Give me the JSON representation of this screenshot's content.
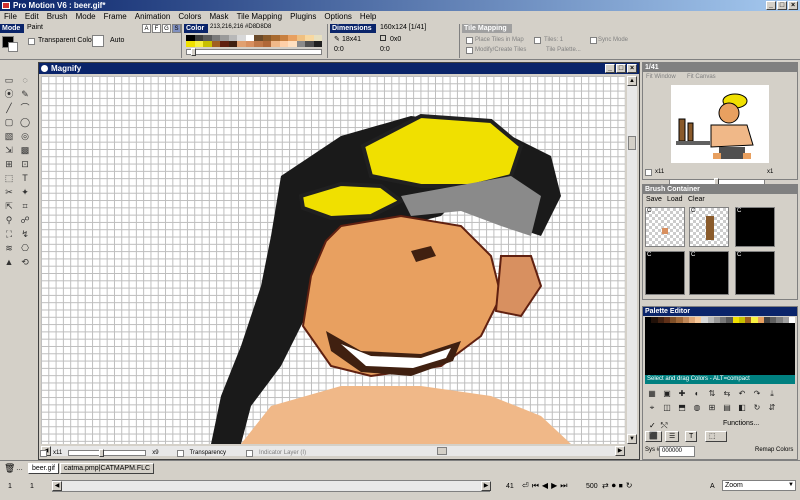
{
  "window": {
    "title": "Pro Motion V6 : beer.gif*"
  },
  "menu": [
    "File",
    "Edit",
    "Brush",
    "Mode",
    "Frame",
    "Animation",
    "Colors",
    "Mask",
    "Tile Mapping",
    "Plugins",
    "Options",
    "Help"
  ],
  "toolbar": {
    "mode": {
      "header": "Mode",
      "value": "Paint",
      "letters": [
        "A",
        "F",
        "G",
        "S"
      ],
      "transparent_label": "Transparent Color:",
      "auto_label": "Auto"
    },
    "color": {
      "header": "Color",
      "value": "213,216,216 #D8D8D8"
    },
    "dimensions": {
      "header": "Dimensions",
      "value": "160x124 [1/41]",
      "brush_size": "18x41",
      "pos1": "0x0",
      "offset_a": "0:0",
      "offset_b": "0:0"
    },
    "tile_mapping": {
      "header": "Tile Mapping",
      "place_tiles": "Place Tiles in Map",
      "tiles_count": "Tiles: 1",
      "sync_mode": "Sync Mode",
      "modify_tiles": "Modify/Create Tiles",
      "tile_palette": "Tile Palette..."
    },
    "colors": [
      "#000000",
      "#3c3c3c",
      "#5a5a5a",
      "#7a7a7a",
      "#9a9a9a",
      "#b8b8b8",
      "#d8d8d8",
      "#ffffff",
      "#6a4a2a",
      "#8a5a2a",
      "#a86a30",
      "#c88040",
      "#e8a060",
      "#f0c080",
      "#f8d8a0",
      "#e8e0c0",
      "#f0e000",
      "#f8f040",
      "#c8c000",
      "#a06020",
      "#602010",
      "#402010",
      "#e0a070",
      "#d89060",
      "#c07848",
      "#b06838",
      "#f0b888",
      "#ffd0a8",
      "#ffe0c0",
      "#8a8a8a",
      "#505050",
      "#202020"
    ]
  },
  "magnify": {
    "title": "Magnify",
    "zoom": "x11",
    "frame": "x9",
    "transparency": "Transparency",
    "indicator": "Indicator Layer (I)"
  },
  "preview": {
    "title": "1/41",
    "fit_window": "Fit Window",
    "fit_canvas": "Fit Canvas",
    "zoom_left": "x11",
    "zoom_right": "x1"
  },
  "brush_container": {
    "title": "Brush Container",
    "save": "Save",
    "load": "Load",
    "clear": "Clear",
    "slot_label": "C"
  },
  "palette_editor": {
    "title": "Palette Editor",
    "status": "Select and drag Colors - ALT=compact",
    "functions": "Functions...",
    "mode_label": "Sys #",
    "hex_value": "000000",
    "remap": "Remap Colors",
    "colors": [
      "#000000",
      "#201008",
      "#402010",
      "#603018",
      "#805028",
      "#a06838",
      "#c08858",
      "#e0a878",
      "#f8c898",
      "#d8d8d8",
      "#b8b8b8",
      "#989898",
      "#787878",
      "#585858",
      "#f0e000",
      "#c8c000",
      "#a06020",
      "#f8f040",
      "#e8a060",
      "#404040",
      "#606060",
      "#808080",
      "#a0a0a0",
      "#ffffff"
    ]
  },
  "status": {
    "frame_num": "1",
    "frame_count": "1",
    "tab1": "beer.gif",
    "tab2": "catma.pmp|CATMAPM.FLC",
    "total_frames": "41",
    "speed": "500",
    "letter_a": "A",
    "zoom": "Zoom"
  }
}
